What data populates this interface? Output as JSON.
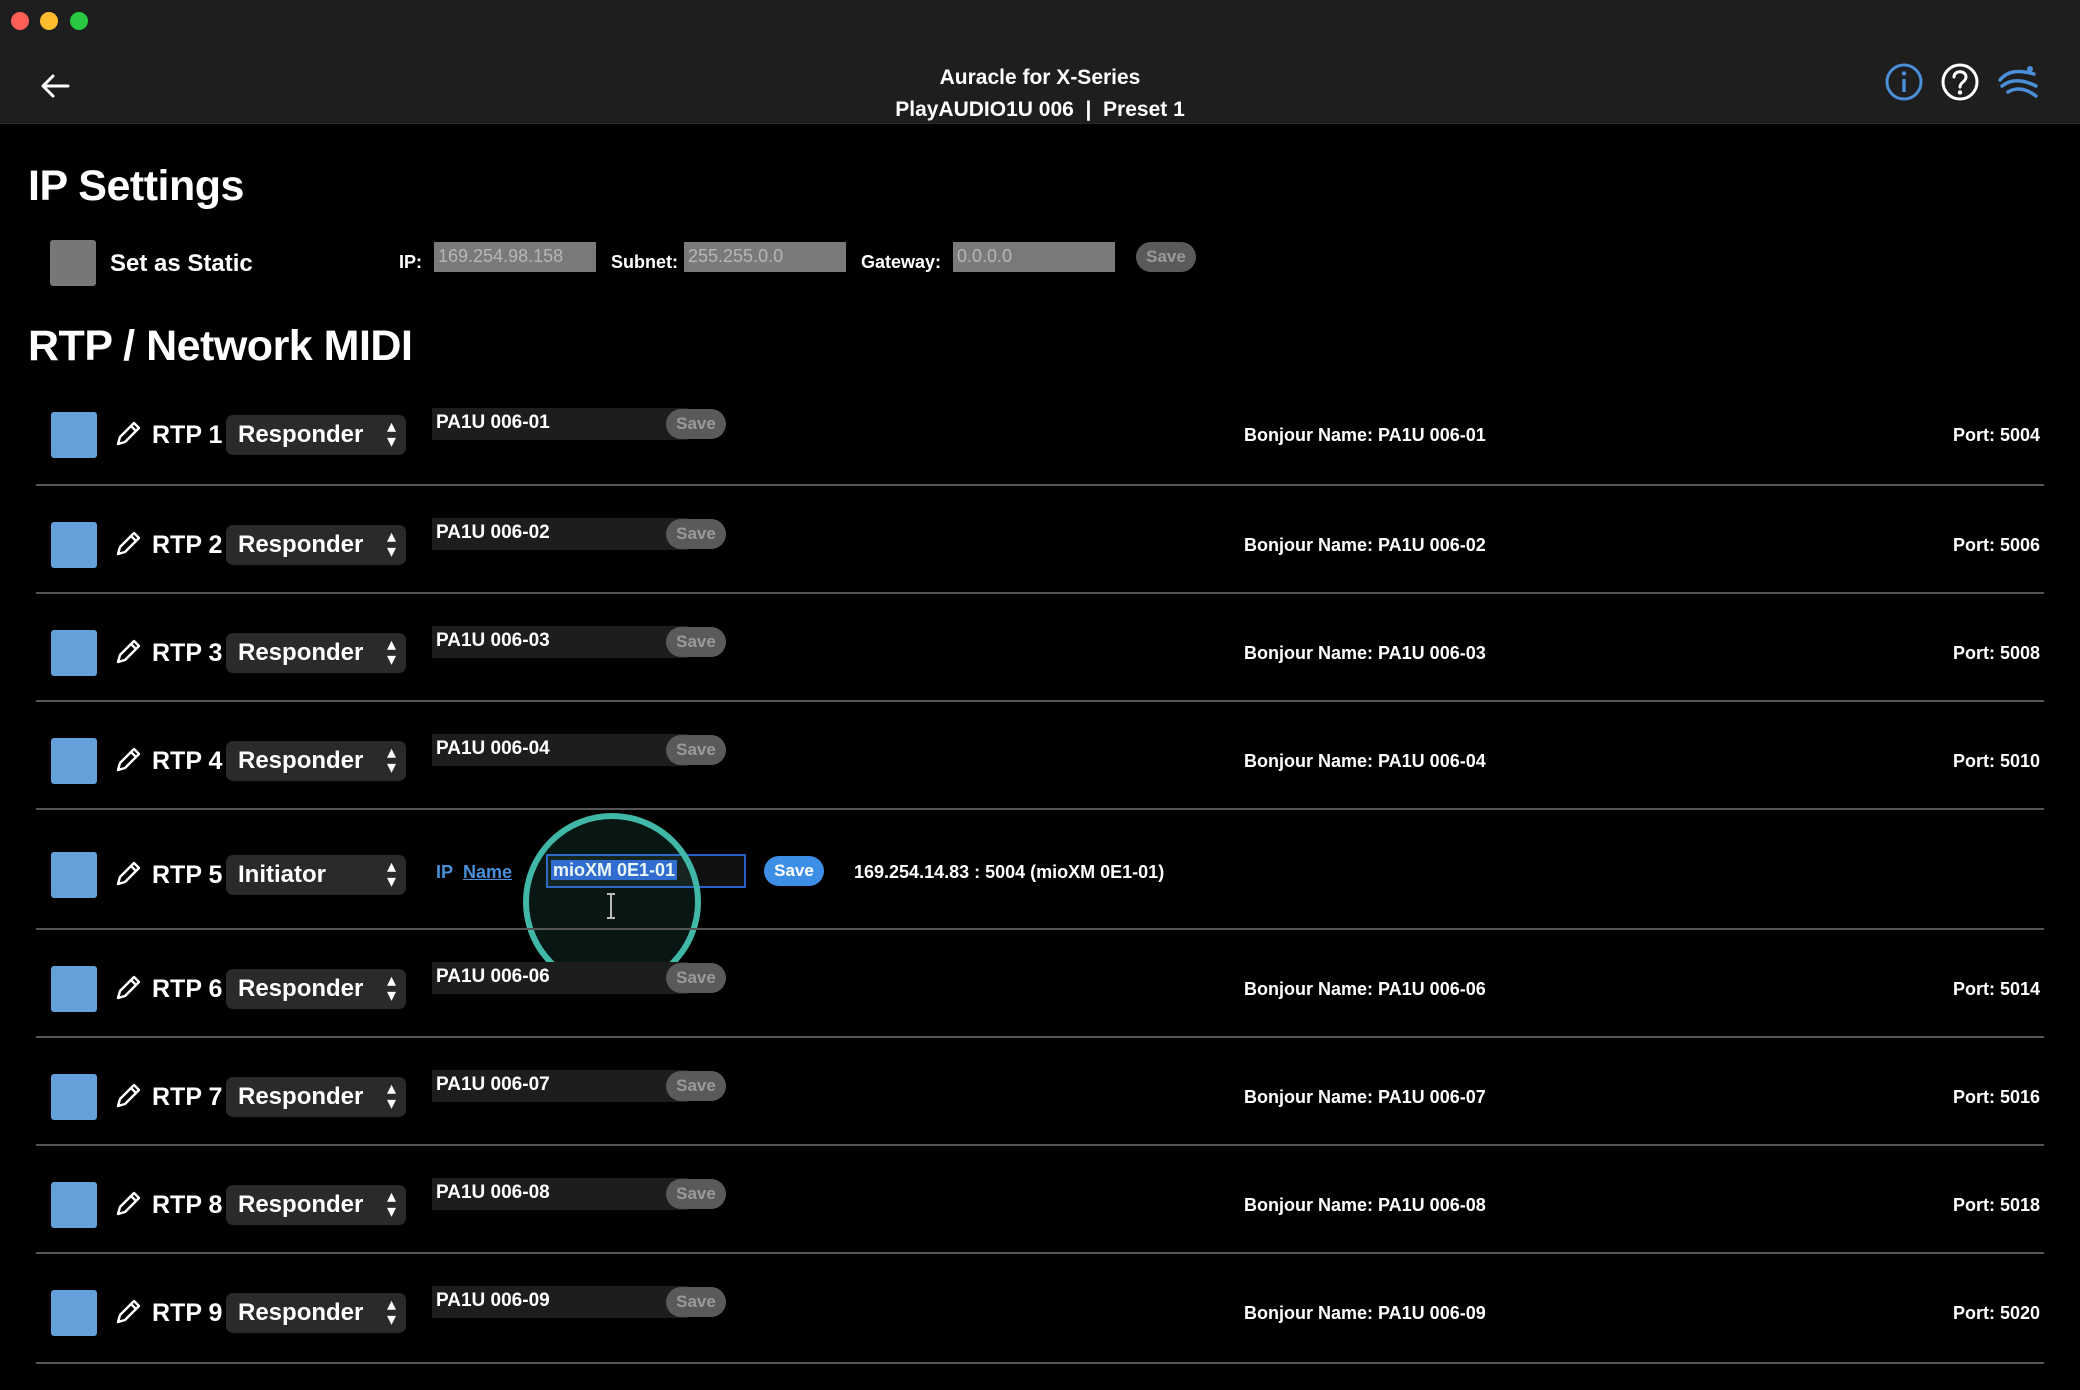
{
  "window": {
    "title_line1": "Auracle for X-Series",
    "title_line2": "PlayAUDIO1U 006  |  Preset 1"
  },
  "header_icons": [
    "info-icon",
    "help-icon",
    "wave-logo-icon"
  ],
  "ip_settings": {
    "title": "IP Settings",
    "static_label": "Set as Static",
    "ip_label": "IP:",
    "ip_value": "169.254.98.158",
    "subnet_label": "Subnet:",
    "subnet_value": "255.255.0.0",
    "gateway_label": "Gateway:",
    "gateway_value": "0.0.0.0",
    "save_label": "Save"
  },
  "rtp": {
    "title": "RTP / Network MIDI",
    "save_label": "Save",
    "rows": [
      {
        "label": "RTP 1",
        "role": "Responder",
        "name": "PA1U 006-01",
        "bonjour": "Bonjour Name: PA1U 006-01",
        "port": "Port: 5004"
      },
      {
        "label": "RTP 2",
        "role": "Responder",
        "name": "PA1U 006-02",
        "bonjour": "Bonjour Name: PA1U 006-02",
        "port": "Port: 5006"
      },
      {
        "label": "RTP 3",
        "role": "Responder",
        "name": "PA1U 006-03",
        "bonjour": "Bonjour Name: PA1U 006-03",
        "port": "Port: 5008"
      },
      {
        "label": "RTP 4",
        "role": "Responder",
        "name": "PA1U 006-04",
        "bonjour": "Bonjour Name: PA1U 006-04",
        "port": "Port: 5010"
      },
      {
        "label": "RTP 5",
        "role": "Initiator",
        "ip_toggle": "IP",
        "name_toggle": "Name",
        "edit_value": "mioXM 0E1-01",
        "destination": "169.254.14.83 : 5004 (mioXM 0E1-01)"
      },
      {
        "label": "RTP 6",
        "role": "Responder",
        "name": "PA1U 006-06",
        "bonjour": "Bonjour Name: PA1U 006-06",
        "port": "Port: 5014"
      },
      {
        "label": "RTP 7",
        "role": "Responder",
        "name": "PA1U 006-07",
        "bonjour": "Bonjour Name: PA1U 006-07",
        "port": "Port: 5016"
      },
      {
        "label": "RTP 8",
        "role": "Responder",
        "name": "PA1U 006-08",
        "bonjour": "Bonjour Name: PA1U 006-08",
        "port": "Port: 5018"
      },
      {
        "label": "RTP 9",
        "role": "Responder",
        "name": "PA1U 006-09",
        "bonjour": "Bonjour Name: PA1U 006-09",
        "port": "Port: 5020"
      }
    ]
  },
  "colors": {
    "accent_blue": "#3c8ee6",
    "checkbox_blue": "#64a0da",
    "click_ring": "#41b8a7"
  }
}
